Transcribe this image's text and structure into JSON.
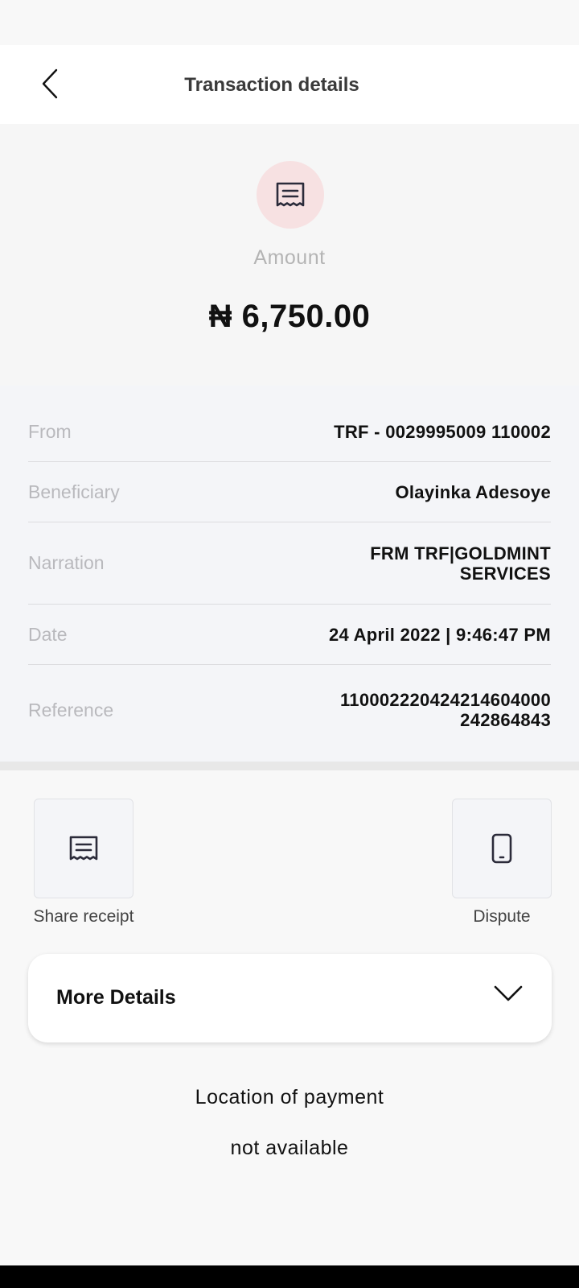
{
  "header": {
    "title": "Transaction details",
    "back_icon": "chevron-left-icon"
  },
  "summary": {
    "icon": "receipt-icon",
    "label": "Amount",
    "amount": "₦ 6,750.00"
  },
  "details": [
    {
      "key": "From",
      "value": "TRF - 0029995009 110002"
    },
    {
      "key": "Beneficiary",
      "value": "Olayinka Adesoye"
    },
    {
      "key": "Narration",
      "value": "FRM TRF|GOLDMINT SERVICES"
    },
    {
      "key": "Date",
      "value": "24 April 2022 | 9:46:47 PM"
    },
    {
      "key": "Reference",
      "value": "110002220424214604000 242864843"
    }
  ],
  "actions": {
    "share_receipt": {
      "label": "Share receipt",
      "icon": "receipt-icon"
    },
    "dispute": {
      "label": "Dispute",
      "icon": "phone-icon"
    }
  },
  "more_details": {
    "label": "More Details",
    "icon": "chevron-down-icon"
  },
  "location": {
    "title": "Location of payment",
    "value": "not available"
  },
  "colors": {
    "accent_soft": "#f7e1e2",
    "details_bg": "#f4f5f8",
    "label_gray": "#b9b9bd"
  }
}
